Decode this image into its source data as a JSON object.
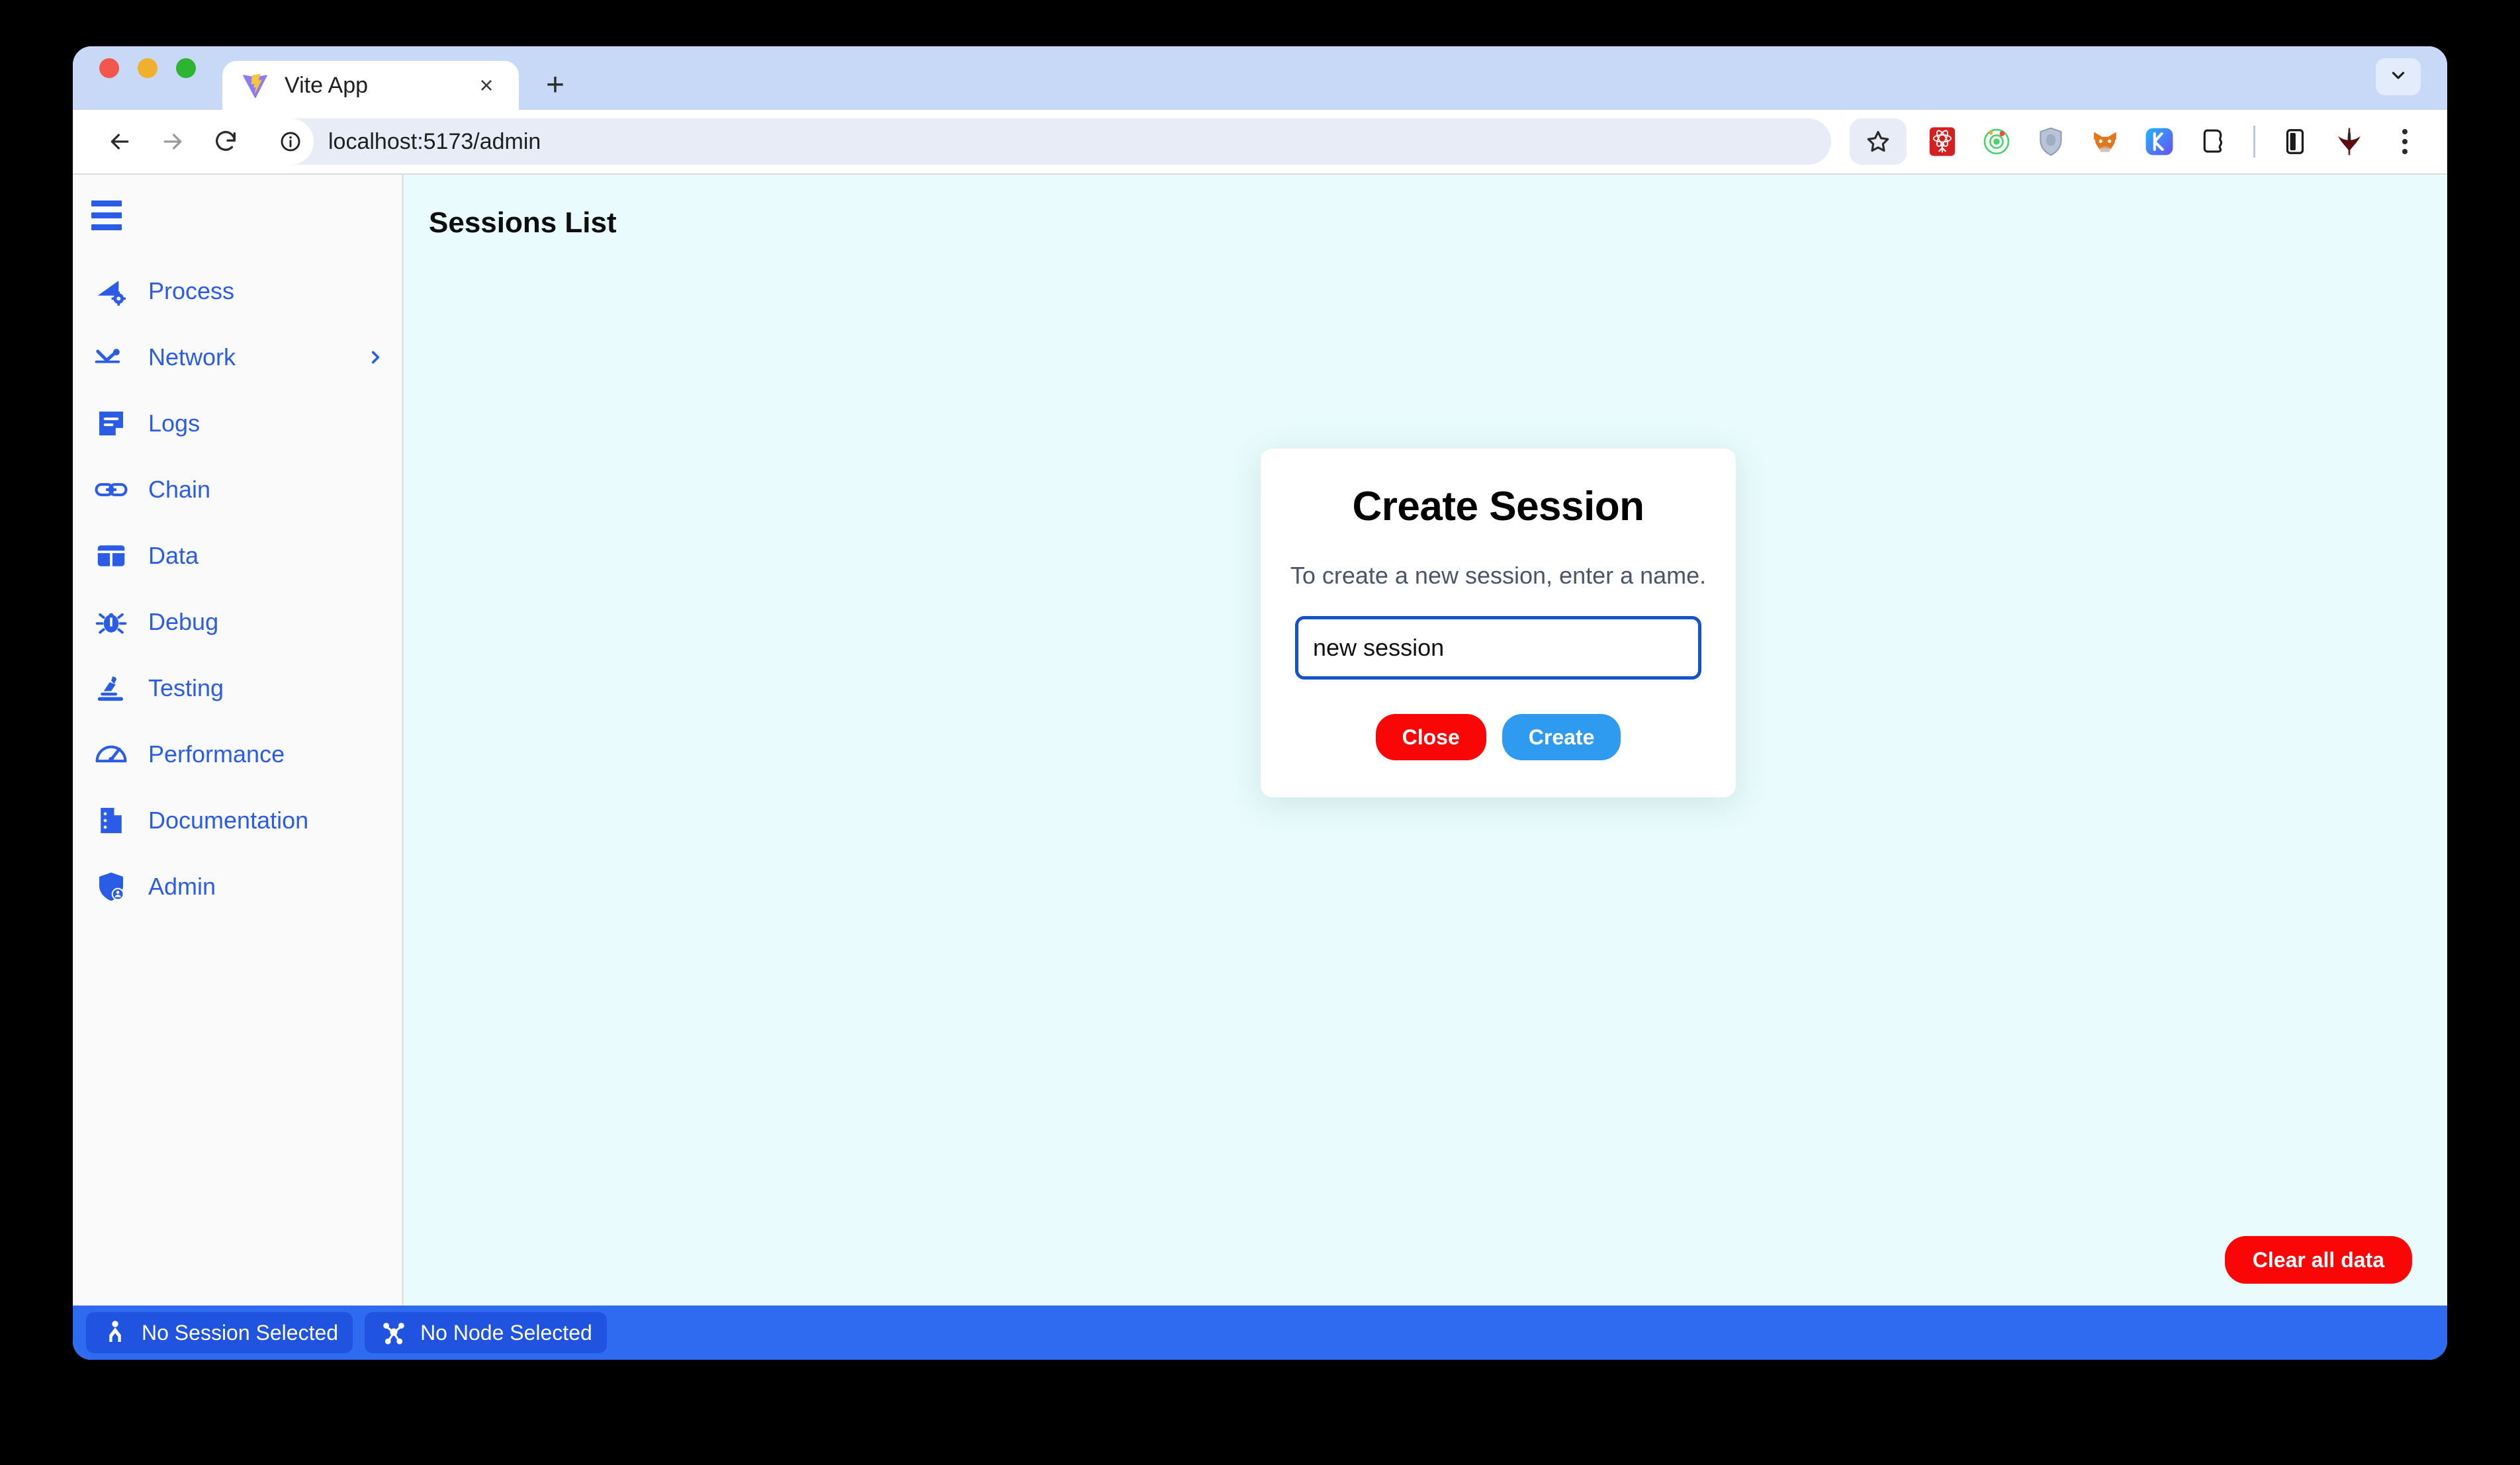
{
  "browser": {
    "tab": {
      "title": "Vite App",
      "favicon": "vite-logo-icon",
      "close": "×"
    },
    "new_tab_label": "+",
    "nav": {
      "back": "back-icon",
      "forward": "forward-icon",
      "reload": "reload-icon"
    },
    "url": "localhost:5173/admin",
    "url_info_icon": "info-circle-icon",
    "toolbar_icons": [
      "bookmark-star-icon",
      "react-devtools-icon",
      "extension-orbit-icon",
      "shield-privacy-icon",
      "metamask-fox-icon",
      "keplr-wallet-icon",
      "phantom-wallet-icon",
      "split-view-icon",
      "extensions-puzzle-icon",
      "kebab-menu-icon"
    ]
  },
  "sidebar": {
    "menu_toggle": "hamburger-menu-icon",
    "items": [
      {
        "label": "Process",
        "icon": "process-gear-icon",
        "chevron": ""
      },
      {
        "label": "Network",
        "icon": "network-icon",
        "chevron": "›"
      },
      {
        "label": "Logs",
        "icon": "logs-note-icon",
        "chevron": ""
      },
      {
        "label": "Chain",
        "icon": "chain-link-icon",
        "chevron": ""
      },
      {
        "label": "Data",
        "icon": "data-grid-icon",
        "chevron": ""
      },
      {
        "label": "Debug",
        "icon": "debug-bug-icon",
        "chevron": ""
      },
      {
        "label": "Testing",
        "icon": "testing-microscope-icon",
        "chevron": ""
      },
      {
        "label": "Performance",
        "icon": "performance-gauge-icon",
        "chevron": ""
      },
      {
        "label": "Documentation",
        "icon": "documentation-file-icon",
        "chevron": ""
      },
      {
        "label": "Admin",
        "icon": "admin-shield-user-icon",
        "chevron": ""
      }
    ]
  },
  "main": {
    "title": "Sessions List",
    "clear_all_label": "Clear all data"
  },
  "modal": {
    "title": "Create Session",
    "description": "To create a new session, enter a name.",
    "input_value": "new session",
    "input_placeholder": "",
    "close_label": "Close",
    "create_label": "Create"
  },
  "statusbar": {
    "session": {
      "label": "No Session Selected",
      "icon": "session-person-icon"
    },
    "node": {
      "label": "No Node Selected",
      "icon": "node-graph-icon"
    }
  },
  "colors": {
    "accent_blue": "#2a5ce6",
    "create_blue": "#2e9af0",
    "danger_red": "#fa0606",
    "statusbar_blue": "#2f6bf0",
    "badge_blue": "#1f53e0",
    "main_bg": "#e9fbfc",
    "sidebar_bg": "#fafafa",
    "tabstrip_bg": "#c7d9f7"
  }
}
